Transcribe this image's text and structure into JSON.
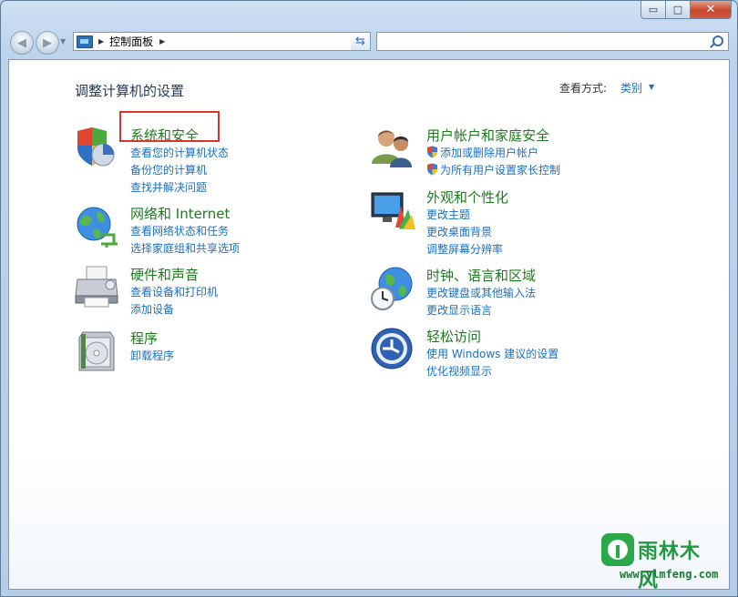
{
  "window": {
    "buttons": {
      "minimize": "▭",
      "maximize": "□",
      "close": "✕"
    }
  },
  "toolbar": {
    "back": "◀",
    "forward": "▶",
    "address_path": "控制面板",
    "search_placeholder": ""
  },
  "content": {
    "page_title": "调整计算机的设置",
    "view_by_label": "查看方式:",
    "view_by_value": "类别"
  },
  "categories": [
    {
      "title": "系统和安全",
      "icon": "shield-pie-icon",
      "links": [
        "查看您的计算机状态",
        "备份您的计算机",
        "查找并解决问题"
      ]
    },
    {
      "title": "网络和 Internet",
      "icon": "globe-network-icon",
      "links": [
        "查看网络状态和任务",
        "选择家庭组和共享选项"
      ]
    },
    {
      "title": "硬件和声音",
      "icon": "printer-icon",
      "links": [
        "查看设备和打印机",
        "添加设备"
      ]
    },
    {
      "title": "程序",
      "icon": "programs-disc-icon",
      "links": [
        "卸载程序"
      ]
    },
    {
      "title": "用户帐户和家庭安全",
      "icon": "users-icon",
      "links": [
        "添加或删除用户帐户",
        "为所有用户设置家长控制"
      ]
    },
    {
      "title": "外观和个性化",
      "icon": "monitor-palette-icon",
      "links": [
        "更改主题",
        "更改桌面背景",
        "调整屏幕分辨率"
      ]
    },
    {
      "title": "时钟、语言和区域",
      "icon": "globe-clock-icon",
      "links": [
        "更改键盘或其他输入法",
        "更改显示语言"
      ]
    },
    {
      "title": "轻松访问",
      "icon": "ease-of-access-icon",
      "links": [
        "使用 Windows 建议的设置",
        "优化视频显示"
      ]
    }
  ],
  "watermark": {
    "name": "雨林木风",
    "url": "www.ylmfeng.com"
  },
  "colors": {
    "title_green": "#1e7a1e",
    "link_blue": "#1a6fc4",
    "highlight_red": "#d9352c"
  }
}
